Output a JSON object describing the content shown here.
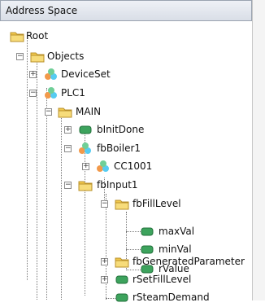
{
  "panel": {
    "title": "Address Space"
  },
  "tree": [
    {
      "id": "root",
      "label": "Root",
      "icon": "folder-icon",
      "expander": "none"
    },
    {
      "id": "objects",
      "label": "Objects",
      "icon": "folder-icon",
      "expander": "minus"
    },
    {
      "id": "deviceset",
      "label": "DeviceSet",
      "icon": "object-icon",
      "expander": "plus"
    },
    {
      "id": "plc1",
      "label": "PLC1",
      "icon": "object-icon",
      "expander": "minus"
    },
    {
      "id": "main",
      "label": "MAIN",
      "icon": "folder-icon",
      "expander": "minus"
    },
    {
      "id": "binitdone",
      "label": "bInitDone",
      "icon": "variable-icon",
      "expander": "plus"
    },
    {
      "id": "fbboiler1",
      "label": "fbBoiler1",
      "icon": "object-icon",
      "expander": "minus"
    },
    {
      "id": "cc1001",
      "label": "CC1001",
      "icon": "object-icon",
      "expander": "plus"
    },
    {
      "id": "fbinput1",
      "label": "fbInput1",
      "icon": "folder-icon",
      "expander": "minus"
    },
    {
      "id": "fbfilllevel",
      "label": "fbFillLevel",
      "icon": "folder-icon",
      "expander": "minus"
    },
    {
      "id": "maxval",
      "label": "maxVal",
      "icon": "variable-icon",
      "expander": "none"
    },
    {
      "id": "minval",
      "label": "minVal",
      "icon": "variable-icon",
      "expander": "none"
    },
    {
      "id": "rvalue",
      "label": "rValue",
      "icon": "variable-icon",
      "expander": "none"
    },
    {
      "id": "fbgenparam",
      "label": "fbGeneratedParameter",
      "icon": "folder-icon",
      "expander": "plus"
    },
    {
      "id": "rsetfilllevel",
      "label": "rSetFillLevel",
      "icon": "variable-icon",
      "expander": "plus"
    },
    {
      "id": "rsteamdemand",
      "label": "rSteamDemand",
      "icon": "variable-icon",
      "expander": "none"
    }
  ]
}
